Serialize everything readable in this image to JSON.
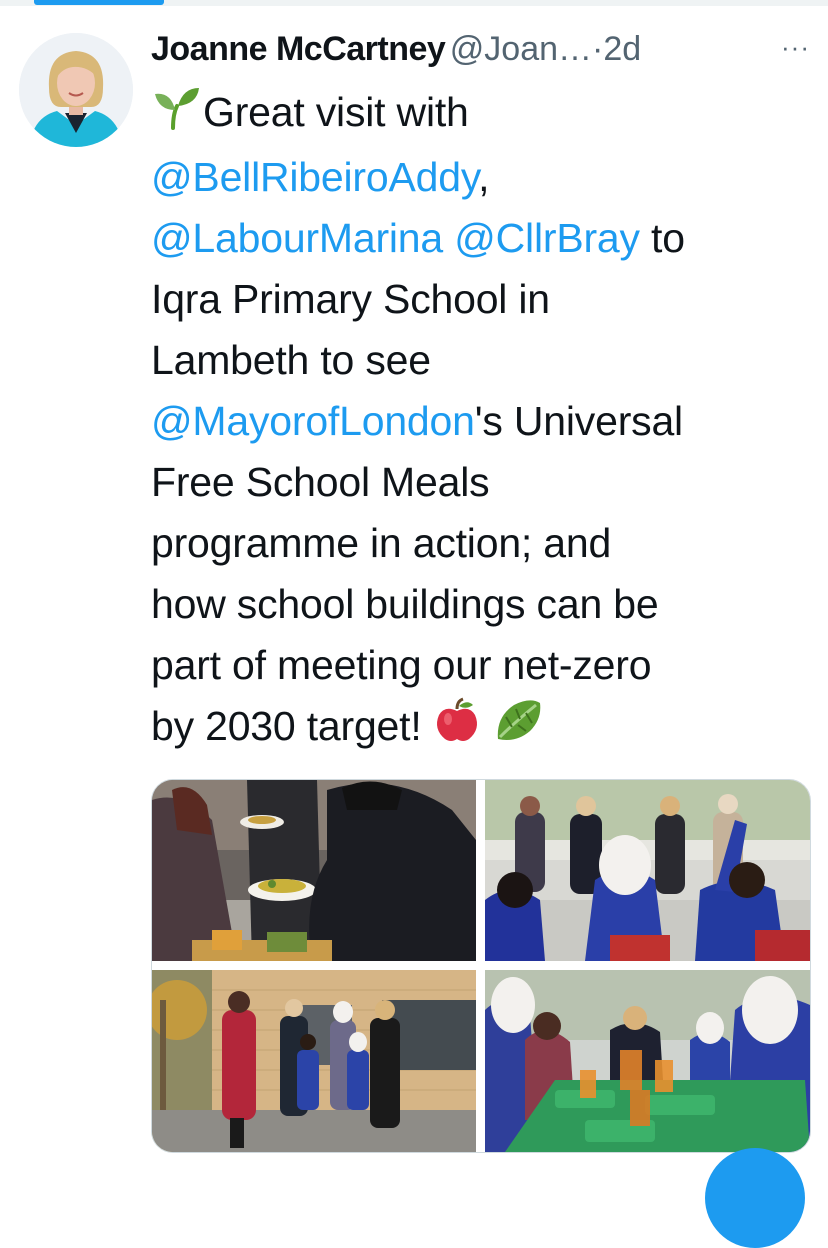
{
  "tweet": {
    "author_name": "Joanne McCartney",
    "handle": "@Joan…",
    "separator": "·",
    "time": "2d",
    "more_label": "···",
    "lines": [
      {
        "segments": [
          {
            "emoji": "seedling-icon"
          },
          {
            "text": "Great visit with",
            "type": "plain"
          }
        ]
      },
      {
        "segments": [
          {
            "text": "@BellRibeiroAddy",
            "type": "mention"
          },
          {
            "text": ",",
            "type": "plain"
          }
        ]
      },
      {
        "segments": [
          {
            "text": "@LabourMarina",
            "type": "mention"
          },
          {
            "text": " ",
            "type": "plain"
          },
          {
            "text": "@CllrBray",
            "type": "mention"
          },
          {
            "text": " to",
            "type": "plain"
          }
        ]
      },
      {
        "segments": [
          {
            "text": "Iqra Primary School in",
            "type": "plain"
          }
        ]
      },
      {
        "segments": [
          {
            "text": "Lambeth to see",
            "type": "plain"
          }
        ]
      },
      {
        "segments": [
          {
            "text": "@MayorofLondon",
            "type": "mention"
          },
          {
            "text": "'s Universal",
            "type": "plain"
          }
        ]
      },
      {
        "segments": [
          {
            "text": "Free School Meals",
            "type": "plain"
          }
        ]
      },
      {
        "segments": [
          {
            "text": "programme in action; and",
            "type": "plain"
          }
        ]
      },
      {
        "segments": [
          {
            "text": "how school buildings can be",
            "type": "plain"
          }
        ]
      },
      {
        "segments": [
          {
            "text": "part of meeting our net-zero",
            "type": "plain"
          }
        ]
      },
      {
        "segments": [
          {
            "text": "by 2030 target! ",
            "type": "plain"
          },
          {
            "emoji": "apple-icon"
          },
          {
            "text": " ",
            "type": "plain"
          },
          {
            "emoji": "leafy-green-icon"
          }
        ]
      }
    ]
  },
  "colors": {
    "mention": "#1d9bf0",
    "text": "#0f1419",
    "secondary": "#536471",
    "accent": "#1d9bf0"
  },
  "media": {
    "photos": [
      "school-lunch-serving-photo",
      "classroom-discussion-photo",
      "group-outside-school-photo",
      "pupils-at-lunch-table-photo"
    ]
  }
}
